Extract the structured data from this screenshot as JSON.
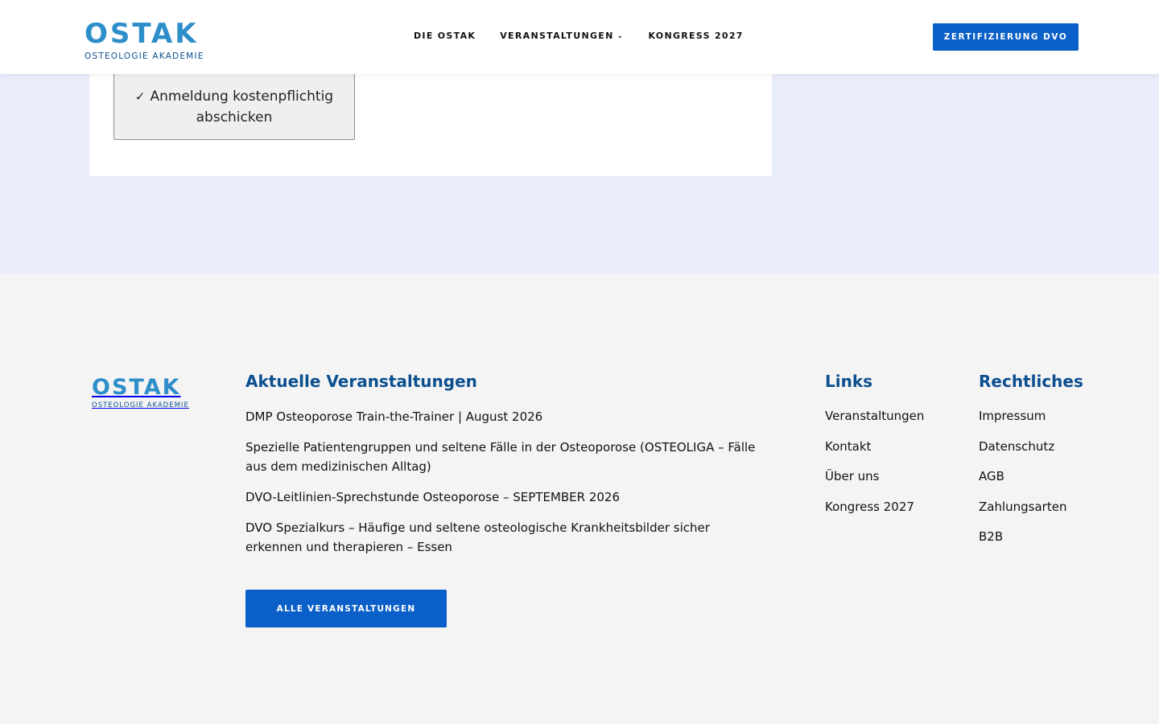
{
  "header": {
    "logo": {
      "word": "OSTAK",
      "sub": "OSTEOLOGIE AKADEMIE"
    },
    "nav": [
      {
        "label": "DIE OSTAK"
      },
      {
        "label": "VERANSTALTUNGEN"
      },
      {
        "label": "KONGRESS 2027"
      }
    ],
    "cta": "ZERTIFIZIERUNG DVO"
  },
  "form": {
    "submit_label": "Anmeldung kostenpflichtig abschicken"
  },
  "footer": {
    "logo": {
      "word": "OSTAK",
      "sub": "OSTEOLOGIE AKADEMIE"
    },
    "events": {
      "title": "Aktuelle Veranstaltungen",
      "items": [
        "DMP Osteoporose Train-the-Trainer | August 2026",
        "Spezielle Patientengruppen und seltene Fälle in der Osteoporose (OSTEOLIGA – Fälle aus dem medizinischen Alltag)",
        "DVO-Leitlinien-Sprechstunde Osteoporose – SEPTEMBER 2026",
        "DVO Spezialkurs – Häufige und seltene osteologische Krankheitsbilder sicher erkennen und therapieren – Essen"
      ],
      "button": "ALLE VERANSTALTUNGEN"
    },
    "links": {
      "title": "Links",
      "items": [
        "Veranstaltungen",
        "Kontakt",
        "Über uns",
        "Kongress 2027"
      ]
    },
    "legal": {
      "title": "Rechtliches",
      "items": [
        "Impressum",
        "Datenschutz",
        "AGB",
        "Zahlungsarten",
        "B2B"
      ]
    }
  },
  "colors": {
    "brand_blue": "#0a5fc8",
    "heading_blue": "#0b4f8f",
    "logo_light_blue": "#2e8ec9",
    "band_lavender": "#e9ecfb",
    "footer_bg": "#f4f4f4"
  }
}
